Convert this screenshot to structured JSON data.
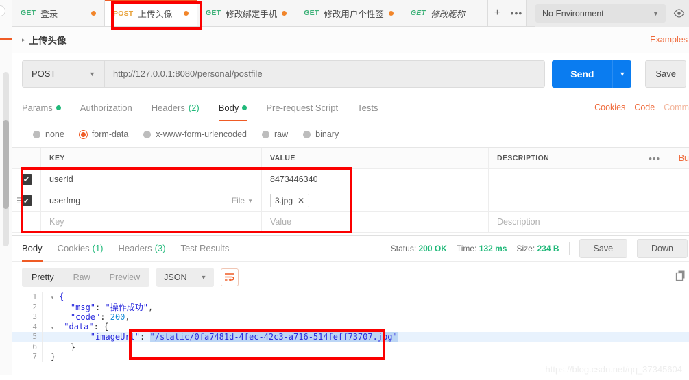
{
  "tabs": {
    "items": [
      {
        "verb": "GET",
        "label": "登录",
        "dot": true,
        "active": false,
        "italic": false
      },
      {
        "verb": "POST",
        "label": "上传头像",
        "dot": true,
        "active": true,
        "italic": false
      },
      {
        "verb": "GET",
        "label": "修改绑定手机",
        "dot": true,
        "active": false,
        "italic": false
      },
      {
        "verb": "GET",
        "label": "修改用户个性签",
        "dot": true,
        "active": false,
        "italic": false
      },
      {
        "verb": "GET",
        "label": "修改昵称",
        "dot": false,
        "active": false,
        "italic": true
      }
    ],
    "new_tab": "+",
    "more": "•••"
  },
  "environment": {
    "selected": "No Environment",
    "caret": "▼",
    "eye_icon": "eye-icon"
  },
  "breadcrumb": {
    "caret": "▸",
    "title": "上传头像",
    "examples_label": "Examples"
  },
  "request": {
    "method": "POST",
    "method_caret": "▼",
    "url": "http://127.0.0.1:8080/personal/postfile",
    "send_label": "Send",
    "send_caret": "▼",
    "save_label": "Save"
  },
  "request_tabs": {
    "items": [
      {
        "label": "Params",
        "dot": true,
        "count": "",
        "active": false
      },
      {
        "label": "Authorization",
        "dot": false,
        "count": "",
        "active": false
      },
      {
        "label": "Headers",
        "dot": false,
        "count": "(2)",
        "active": false
      },
      {
        "label": "Body",
        "dot": true,
        "count": "",
        "active": true
      },
      {
        "label": "Pre-request Script",
        "dot": false,
        "count": "",
        "active": false
      },
      {
        "label": "Tests",
        "dot": false,
        "count": "",
        "active": false
      }
    ],
    "links": [
      "Cookies",
      "Code",
      "Comm"
    ]
  },
  "body_types": {
    "options": [
      {
        "label": "none",
        "selected": false
      },
      {
        "label": "form-data",
        "selected": true
      },
      {
        "label": "x-www-form-urlencoded",
        "selected": false
      },
      {
        "label": "raw",
        "selected": false
      },
      {
        "label": "binary",
        "selected": false
      }
    ]
  },
  "form_table": {
    "headers": {
      "key": "KEY",
      "value": "VALUE",
      "description": "DESCRIPTION"
    },
    "dots_menu": "•••",
    "bulk_edit": "Bu",
    "rows": [
      {
        "checked": true,
        "key": "userId",
        "type": "",
        "value": "8473446340",
        "value_is_chip": false,
        "description": ""
      },
      {
        "checked": true,
        "key": "userImg",
        "type": "File",
        "type_caret": "▼",
        "value": "3.jpg",
        "value_is_chip": true,
        "chip_close": "✕",
        "description": ""
      },
      {
        "checked": false,
        "key": "Key",
        "type": "",
        "value": "Value",
        "value_is_chip": false,
        "description": "Description",
        "placeholder_row": true
      }
    ]
  },
  "response": {
    "tabs": [
      {
        "label": "Body",
        "count": "",
        "active": true
      },
      {
        "label": "Cookies",
        "count": "(1)",
        "active": false
      },
      {
        "label": "Headers",
        "count": "(3)",
        "active": false
      },
      {
        "label": "Test Results",
        "count": "",
        "active": false
      }
    ],
    "status_label": "Status:",
    "status_value": "200 OK",
    "time_label": "Time:",
    "time_value": "132 ms",
    "size_label": "Size:",
    "size_value": "234 B",
    "save_label": "Save",
    "download_label": "Down",
    "view_modes": [
      {
        "label": "Pretty",
        "active": true
      },
      {
        "label": "Raw",
        "active": false
      },
      {
        "label": "Preview",
        "active": false
      }
    ],
    "format": "JSON",
    "format_caret": "▼",
    "wrap_icon": "wrap-lines-icon",
    "copy_icon": "copy-icon",
    "body_lines": [
      {
        "num": "1",
        "fold": true,
        "text": "{"
      },
      {
        "num": "2",
        "fold": false,
        "text": "    \"msg\": \"操作成功\","
      },
      {
        "num": "3",
        "fold": false,
        "text": "    \"code\": 200,"
      },
      {
        "num": "4",
        "fold": true,
        "text": "    \"data\": {"
      },
      {
        "num": "5",
        "fold": false,
        "text": "        \"imageUrl\": \"/static/0fa7481d-4fec-42c3-a716-514feff73707.jpg\"",
        "highlight": true
      },
      {
        "num": "6",
        "fold": false,
        "text": "    }"
      },
      {
        "num": "7",
        "fold": false,
        "text": "}"
      }
    ],
    "image_url_value": "\"/static/0fa7481d-4fec-42c3-a716-514feff73707.jpg\"",
    "image_url_key": "\"imageUrl\""
  },
  "watermark": "https://blog.csdn.net/qq_37345604",
  "colors": {
    "accent_orange": "#ef5b25",
    "send_blue": "#0a7cf0",
    "status_green": "#21b97a",
    "annotation_red": "#fb0000"
  }
}
